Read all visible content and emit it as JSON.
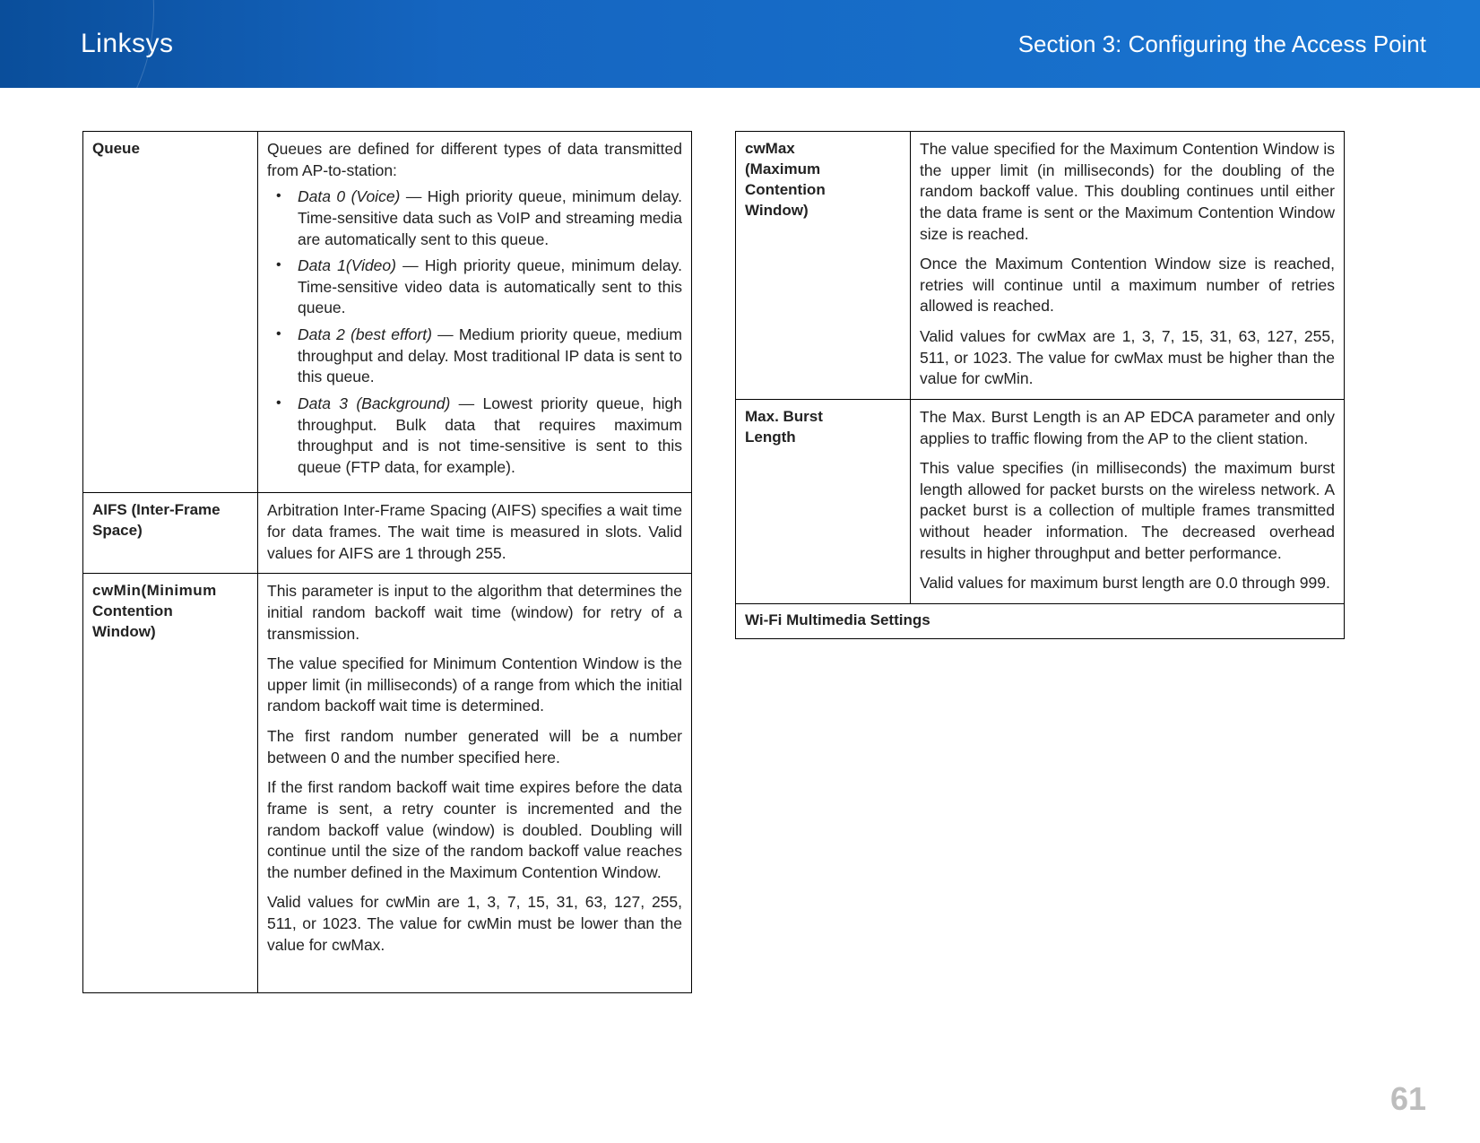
{
  "header": {
    "brand": "Linksys",
    "section": "Section 3:  Configuring the Access Point"
  },
  "pageNumber": "61",
  "left": {
    "queue": {
      "label": "Queue",
      "intro": "Queues are defined for different types of data transmitted from AP-to-station:",
      "items": [
        {
          "name": "Data 0 (Voice)",
          "dash": " — ",
          "text": "High priority queue, minimum delay. Time-sensitive data such as VoIP and streaming media are automatically sent to this queue."
        },
        {
          "name": "Data 1(Video)",
          "dash": " — ",
          "text": "High priority queue, minimum delay. Time-sensitive video data is automatically sent to this queue."
        },
        {
          "name": "Data 2 (best effort)",
          "dash": " — ",
          "text": "Medium priority queue, medium throughput and delay. Most traditional IP data is sent to this queue."
        },
        {
          "name": "Data 3 (Background)",
          "dash": " — ",
          "text": "Lowest priority queue, high throughput. Bulk data that requires maximum throughput and is not time-sensitive is sent to this queue (FTP data, for example)."
        }
      ]
    },
    "aifs": {
      "label": "AIFS (Inter-Frame Space)",
      "text": "Arbitration Inter-Frame Spacing (AIFS) specifies a wait time for data frames. The wait time is measured in slots. Valid values for AIFS are 1 through 255."
    },
    "cwmin": {
      "label_l1": "cwMin(Minimum",
      "label_l2": "Contention",
      "label_l3": "Window)",
      "p1": "This parameter is input to the algorithm that determines the initial random backoff wait time (window) for retry of a transmission.",
      "p2": "The value specified for Minimum Contention Window is the upper limit (in milliseconds) of a range from which the initial random backoff wait time is determined.",
      "p3": "The first random number generated will be a number between 0 and the number specified here.",
      "p4": "If the first random backoff wait time expires before the data frame is sent, a retry counter is incremented and the random backoff value (window) is doubled. Doubling will continue until the size of the random backoff value reaches the number defined in the Maximum Contention Window.",
      "p5": "Valid values for cwMin are 1, 3, 7, 15, 31, 63, 127, 255, 511, or 1023. The value for cwMin must be lower than the value for cwMax."
    }
  },
  "right": {
    "cwmax": {
      "label_l1": "cwMax",
      "label_l2": "(Maximum",
      "label_l3": "Contention",
      "label_l4": "Window)",
      "p1": "The value specified for the Maximum Contention Window is the upper limit (in milliseconds) for the doubling of the random backoff value. This doubling continues until either the data frame is sent or the Maximum Contention Window size is reached.",
      "p2": "Once the Maximum Contention Window size is reached, retries will continue until a maximum number of retries allowed is reached.",
      "p3": "Valid values for cwMax are 1, 3, 7, 15, 31, 63, 127, 255, 511, or 1023. The value for cwMax must be higher than the value for cwMin."
    },
    "burst": {
      "label_l1": "Max. Burst",
      "label_l2": "Length",
      "p1": "The Max. Burst Length is an AP EDCA parameter and only applies to traffic flowing from the AP to the client station.",
      "p2": "This value specifies (in milliseconds) the maximum burst length allowed for packet bursts on the wireless network. A packet burst is a collection of multiple frames transmitted without header information. The decreased overhead results in higher throughput and better performance.",
      "p3": "Valid values for maximum burst length are 0.0 through 999."
    },
    "caption": "Wi-Fi Multimedia Settings"
  }
}
